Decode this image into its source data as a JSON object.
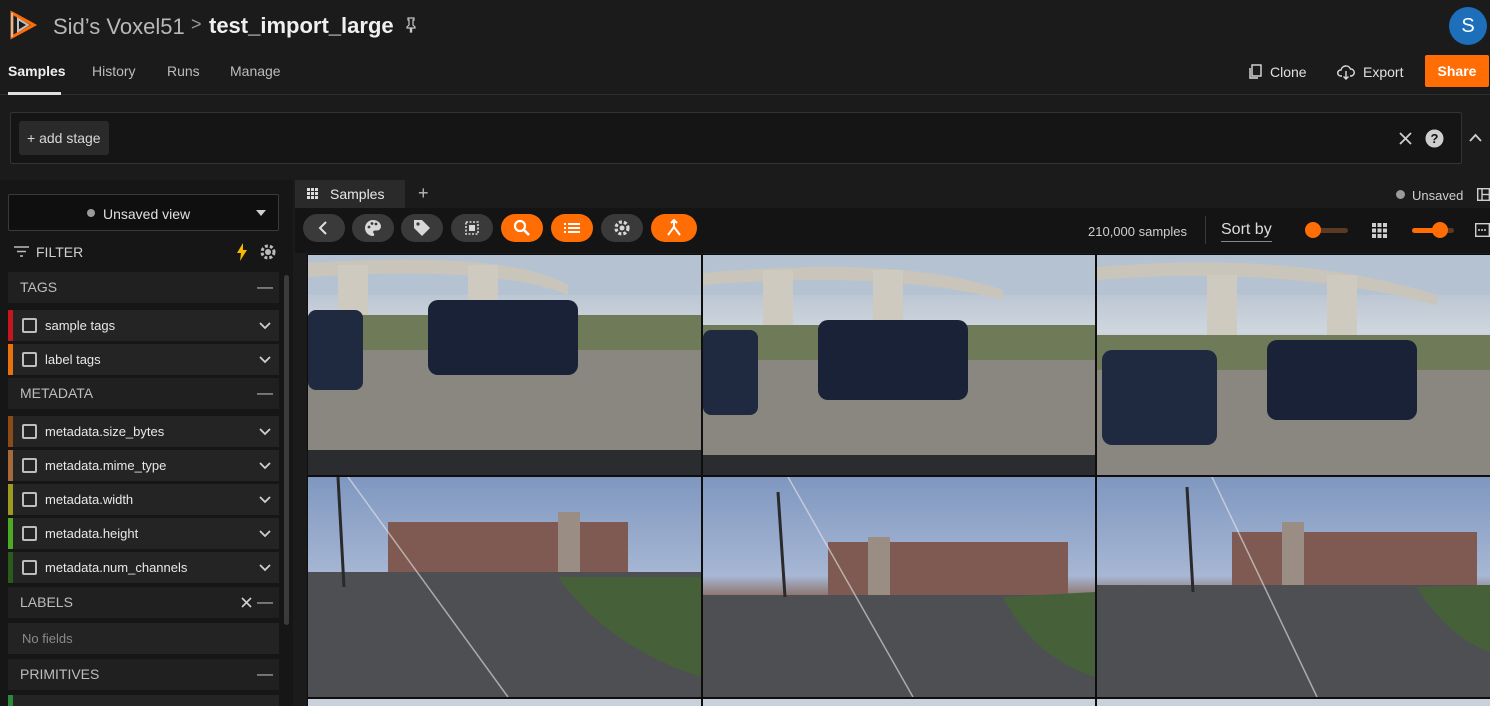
{
  "header": {
    "org": "Sid’s Voxel51",
    "separator": ">",
    "dataset_name": "test_import_large",
    "avatar_initial": "S",
    "colors": {
      "accent": "#ff6d04",
      "avatar": "#1c6fb8"
    }
  },
  "nav": {
    "tabs": [
      {
        "label": "Samples",
        "active": true
      },
      {
        "label": "History",
        "active": false
      },
      {
        "label": "Runs",
        "active": false
      },
      {
        "label": "Manage",
        "active": false
      }
    ],
    "clone_label": "Clone",
    "export_label": "Export",
    "share_label": "Share"
  },
  "view_bar": {
    "add_stage_label": "+ add stage"
  },
  "sidebar": {
    "view_selector": "Unsaved view",
    "filter_label": "FILTER",
    "groups": {
      "tags": "TAGS",
      "metadata": "METADATA",
      "labels": "LABELS",
      "primitives": "PRIMITIVES"
    },
    "tag_fields": [
      "sample tags",
      "label tags"
    ],
    "metadata_fields": [
      "metadata.size_bytes",
      "metadata.mime_type",
      "metadata.width",
      "metadata.height",
      "metadata.num_channels"
    ],
    "labels_empty": "No fields",
    "field_colors": [
      "#c4161c",
      "#e8730c",
      "#8a4b16",
      "#a8693a",
      "#9c9a1f",
      "#4caa23",
      "#2a5a1c"
    ]
  },
  "main": {
    "tab_label": "Samples",
    "add_tab": "+",
    "unsaved_label": "Unsaved",
    "sample_count": "210,000 samples",
    "sort_by": "Sort by",
    "slider1_level": 0.1,
    "slider2_level": 0.75
  }
}
